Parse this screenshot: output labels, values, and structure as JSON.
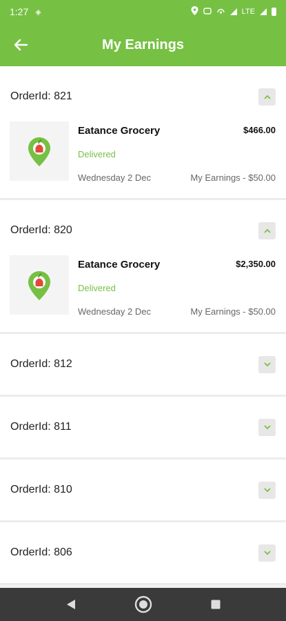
{
  "status_bar": {
    "time": "1:27",
    "network": "LTE"
  },
  "header": {
    "title": "My Earnings"
  },
  "orders": [
    {
      "id_label": "OrderId: 821",
      "expanded": true,
      "item": {
        "store": "Eatance Grocery",
        "price": "$466.00",
        "status": "Delivered",
        "date": "Wednesday 2 Dec",
        "earnings": "My Earnings - $50.00"
      }
    },
    {
      "id_label": "OrderId: 820",
      "expanded": true,
      "item": {
        "store": "Eatance Grocery",
        "price": "$2,350.00",
        "status": "Delivered",
        "date": "Wednesday 2 Dec",
        "earnings": "My Earnings - $50.00"
      }
    },
    {
      "id_label": "OrderId: 812",
      "expanded": false
    },
    {
      "id_label": "OrderId: 811",
      "expanded": false
    },
    {
      "id_label": "OrderId: 810",
      "expanded": false
    },
    {
      "id_label": "OrderId: 806",
      "expanded": false
    }
  ],
  "colors": {
    "accent": "#76c043",
    "status_delivered": "#76c043",
    "nav_bar": "#3a3a3a"
  },
  "icons": {
    "back": "arrow-left-icon",
    "expand": "chevron-down-icon",
    "collapse": "chevron-up-icon",
    "store_logo": "grocery-pin-logo"
  }
}
